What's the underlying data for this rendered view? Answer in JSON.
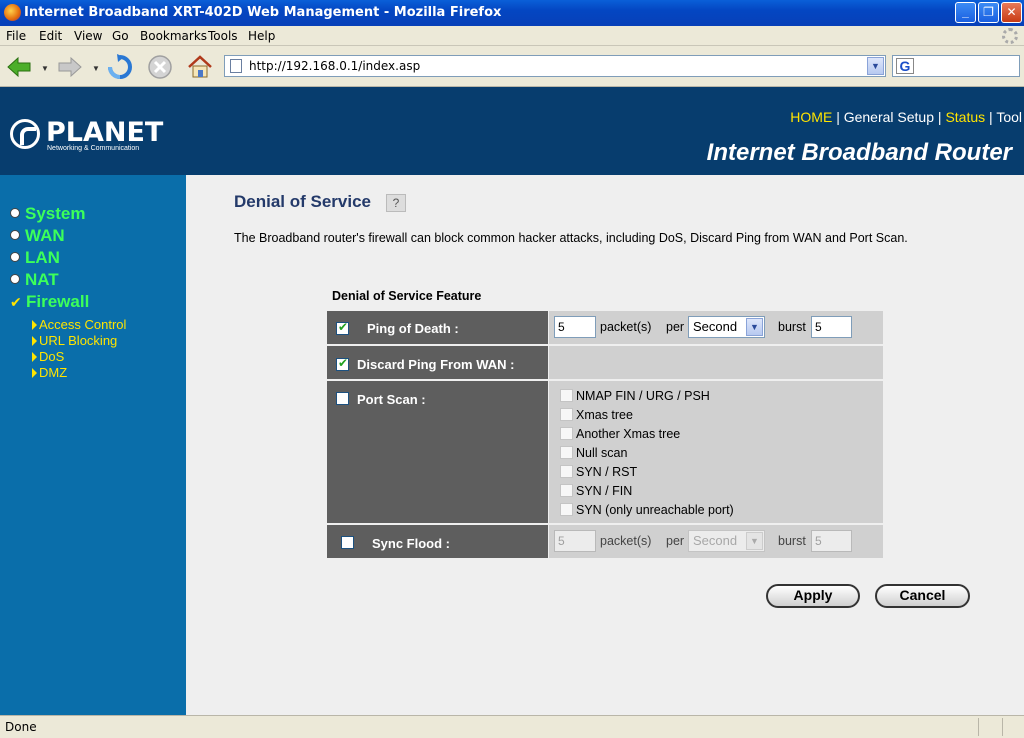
{
  "window": {
    "title": "Internet Broadband XRT-402D Web Management - Mozilla Firefox"
  },
  "menu": [
    "File",
    "Edit",
    "View",
    "Go",
    "Bookmarks",
    "Tools",
    "Help"
  ],
  "address_bar": {
    "url": "http://192.168.0.1/index.asp"
  },
  "search": {
    "engine_letter": "G"
  },
  "header": {
    "brand": "PLANET",
    "tagline": "Networking & Communication",
    "nav": {
      "home": "HOME",
      "general_setup": "General Setup",
      "status": "Status",
      "tool": "Tool",
      "separator": "|"
    },
    "product": "Internet Broadband Router"
  },
  "sidebar": {
    "items": [
      "System",
      "WAN",
      "LAN",
      "NAT",
      "Firewall"
    ],
    "sub_items": [
      "Access Control",
      "URL Blocking",
      "DoS",
      "DMZ"
    ]
  },
  "main": {
    "title": "Denial of Service",
    "description": "The Broadband router's firewall can block common hacker attacks, including DoS, Discard Ping from WAN and Port Scan.",
    "feature_heading": "Denial of Service Feature",
    "ping_of_death": {
      "label": "Ping of Death :",
      "packets": "5",
      "packets_unit": "packet(s)",
      "per": "per",
      "period": "Second",
      "burst_label": "burst",
      "burst": "5",
      "checked": true
    },
    "discard_ping": {
      "label": "Discard Ping From WAN :",
      "checked": true
    },
    "port_scan": {
      "label": "Port Scan :",
      "checked": false,
      "options": [
        "NMAP FIN / URG / PSH",
        "Xmas tree",
        "Another Xmas tree",
        "Null scan",
        "SYN / RST",
        "SYN / FIN",
        "SYN (only unreachable port)"
      ]
    },
    "sync_flood": {
      "label": "Sync Flood :",
      "packets": "5",
      "packets_unit": "packet(s)",
      "per": "per",
      "period": "Second",
      "burst_label": "burst",
      "burst": "5",
      "checked": false
    },
    "buttons": {
      "apply": "Apply",
      "cancel": "Cancel"
    }
  },
  "status_bar": {
    "text": "Done"
  },
  "colors": {
    "header_bg": "#073d6e",
    "sidebar_bg": "#0a6eaa",
    "sidebar_item": "#3cff5a",
    "accent_yellow": "#ffe400",
    "title_color": "#243a6a"
  }
}
